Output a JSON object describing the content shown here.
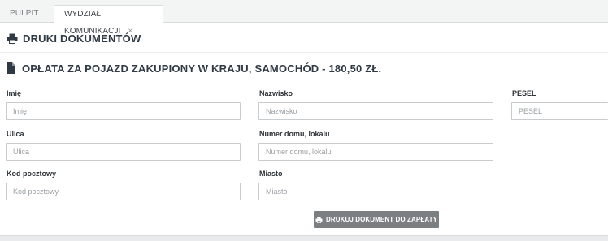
{
  "tabs": [
    {
      "label": "PULPIT"
    },
    {
      "label": "WYDZIAŁ KOMUNIKACJI",
      "close": "×"
    }
  ],
  "section": {
    "title": "DRUKI DOKUMENTÓW",
    "icon": "printer-icon"
  },
  "document": {
    "title": "OPŁATA ZA POJAZD ZAKUPIONY W KRAJU, SAMOCHÓD - 180,50 ZŁ.",
    "icon": "document-icon"
  },
  "form": {
    "imie": {
      "label": "Imię",
      "placeholder": "Imię",
      "value": ""
    },
    "nazwisko": {
      "label": "Nazwisko",
      "placeholder": "Nazwisko",
      "value": ""
    },
    "pesel": {
      "label": "PESEL",
      "placeholder": "PESEL",
      "value": ""
    },
    "ulica": {
      "label": "Ulica",
      "placeholder": "Ulica",
      "value": ""
    },
    "numer": {
      "label": "Numer domu, lokalu",
      "placeholder": "Numer domu, lokalu",
      "value": ""
    },
    "kod": {
      "label": "Kod pocztowy",
      "placeholder": "Kod pocztowy",
      "value": ""
    },
    "miasto": {
      "label": "Miasto",
      "placeholder": "Miasto",
      "value": ""
    }
  },
  "print_button": {
    "label": "DRUKUJ DOKUMENT DO ZAPŁATY",
    "icon": "printer-icon"
  }
}
